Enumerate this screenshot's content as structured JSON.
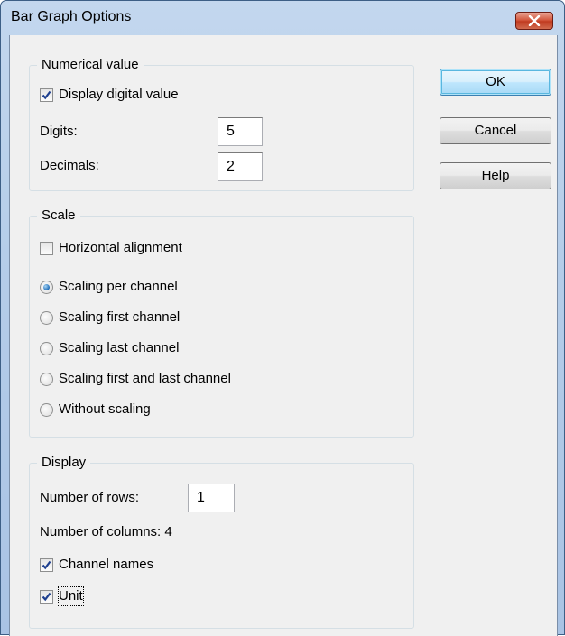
{
  "window": {
    "title": "Bar Graph Options"
  },
  "numerical": {
    "legend": "Numerical value",
    "display_digital_label": "Display digital value",
    "display_digital_checked": true,
    "digits_label": "Digits:",
    "digits_value": "5",
    "decimals_label": "Decimals:",
    "decimals_value": "2"
  },
  "scale": {
    "legend": "Scale",
    "horizontal_label": "Horizontal alignment",
    "horizontal_checked": false,
    "options": [
      "Scaling per channel",
      "Scaling first channel",
      "Scaling last channel",
      "Scaling first and last channel",
      "Without scaling"
    ],
    "selected": "Scaling per channel"
  },
  "display": {
    "legend": "Display",
    "rows_label": "Number of rows:",
    "rows_value": "1",
    "columns_text": "Number of columns: 4",
    "channel_names_label": "Channel names",
    "channel_names_checked": true,
    "unit_label": "Unit",
    "unit_checked": true
  },
  "buttons": {
    "ok": "OK",
    "cancel": "Cancel",
    "help": "Help"
  },
  "colors": {
    "titlebar": "#b5cde9",
    "close_button": "#c8472b",
    "dialog_face": "#f0f0f0",
    "check_mark": "#1e3f8f",
    "radio_dot": "#1c6ab6"
  },
  "icons": {
    "close": "close-x-icon",
    "check": "checkmark-icon",
    "radio": "radio-dot-icon"
  }
}
